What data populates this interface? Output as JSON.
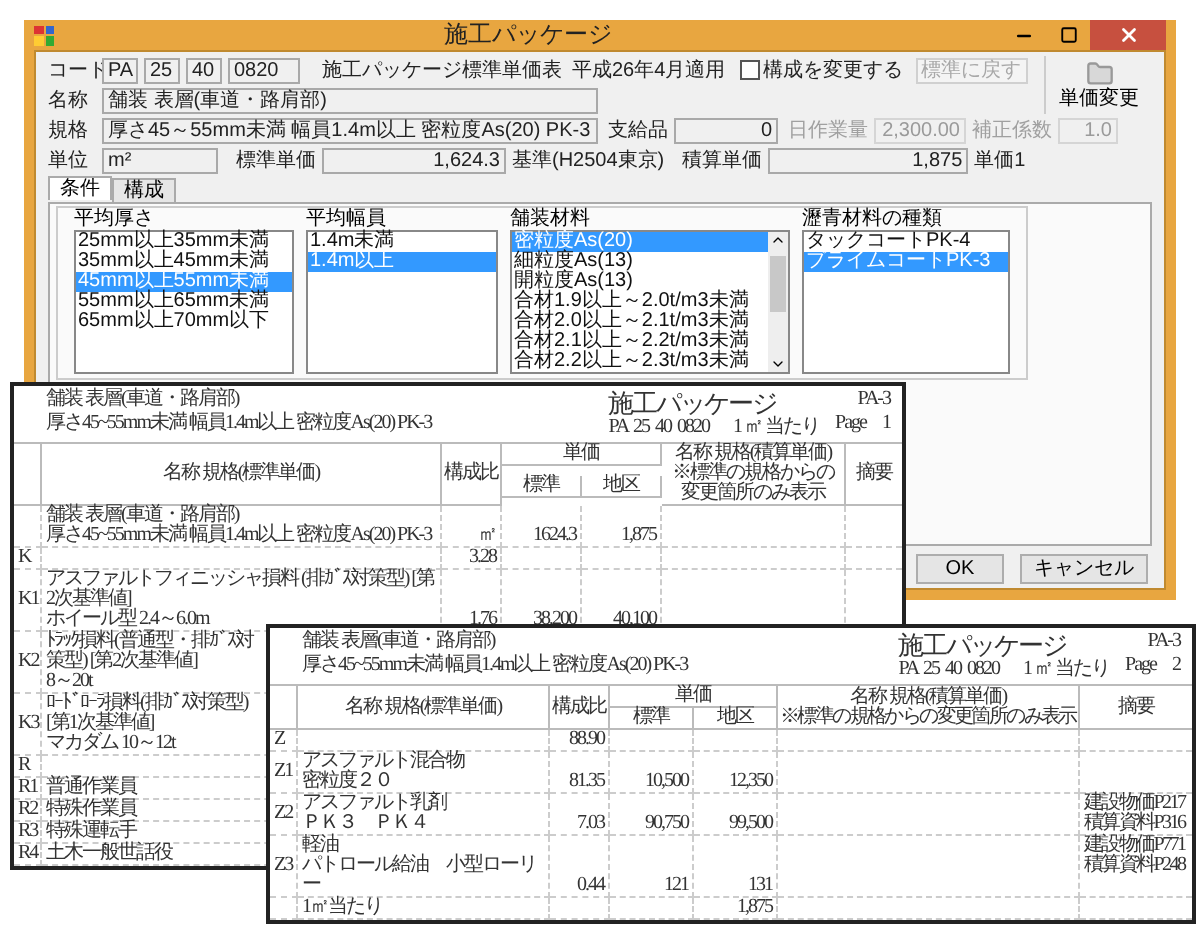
{
  "window": {
    "title": "施工パッケージ"
  },
  "header": {
    "code_label": "コード",
    "code": [
      "PA",
      "25",
      "40",
      "0820"
    ],
    "table_name": "施工パッケージ標準単価表",
    "applied": "平成26年4月適用",
    "change_structure": {
      "label": "構成を変更する",
      "checked": false
    },
    "reset_button": {
      "label": "標準に戻す",
      "disabled": true
    },
    "price_change_button": {
      "label": "単価変更"
    },
    "name": {
      "label": "名称",
      "value": "舗装 表層(車道・路肩部)"
    },
    "spec": {
      "label": "規格",
      "value": "厚さ45～55mm未満 幅員1.4m以上 密粒度As(20) PK-3"
    },
    "supplied": {
      "label": "支給品",
      "value": "0"
    },
    "daily_output": {
      "label": "日作業量",
      "value": "2,300.00",
      "disabled": true
    },
    "correction": {
      "label": "補正係数",
      "value": "1.0",
      "disabled": true
    },
    "unit": {
      "label": "単位",
      "value": "m²"
    },
    "standard_price": {
      "label": "標準単価",
      "value": "1,624.3"
    },
    "basis": "基準(H2504東京)",
    "estimate_price": {
      "label": "積算単価",
      "value": "1,875"
    },
    "price_note": "単価1"
  },
  "tabs": [
    {
      "label": "条件",
      "selected": true
    },
    {
      "label": "構成",
      "selected": false
    }
  ],
  "conditions": [
    {
      "title": "平均厚さ",
      "items": [
        {
          "label": "25mm以上35mm未満",
          "selected": false
        },
        {
          "label": "35mm以上45mm未満",
          "selected": false
        },
        {
          "label": "45mm以上55mm未満",
          "selected": true
        },
        {
          "label": "55mm以上65mm未満",
          "selected": false
        },
        {
          "label": "65mm以上70mm以下",
          "selected": false
        }
      ]
    },
    {
      "title": "平均幅員",
      "items": [
        {
          "label": "1.4m未満",
          "selected": false
        },
        {
          "label": "1.4m以上",
          "selected": true
        }
      ]
    },
    {
      "title": "舗装材料",
      "items": [
        {
          "label": "密粒度As(20)",
          "selected": true
        },
        {
          "label": "細粒度As(13)",
          "selected": false
        },
        {
          "label": "開粒度As(13)",
          "selected": false
        },
        {
          "label": "合材1.9以上～2.0t/m3未満",
          "selected": false
        },
        {
          "label": "合材2.0以上～2.1t/m3未満",
          "selected": false
        },
        {
          "label": "合材2.1以上～2.2t/m3未満",
          "selected": false
        },
        {
          "label": "合材2.2以上～2.3t/m3未満",
          "selected": false
        }
      ]
    },
    {
      "title": "瀝青材料の種類",
      "items": [
        {
          "label": "タックコートPK-4",
          "selected": false
        },
        {
          "label": "プライムコートPK-3",
          "selected": true
        }
      ]
    }
  ],
  "buttons": [
    {
      "label": "OK"
    },
    {
      "label": "キャンセル"
    }
  ],
  "pages": [
    {
      "heading": "舗装 表層(車道・路肩部)",
      "spec": "厚さ45~55mm未満 幅員1.4m以上 密粒度As(20) PK-3",
      "title": "施工パッケージ",
      "code": "PA  25  40  0820",
      "per_unit": "1 ㎡ 当たり",
      "form": "PA-3",
      "page_label": "Page",
      "page_no": "1",
      "columns": {
        "name": "名称 規格(標準単価)",
        "ratio": "構成比",
        "price": "単価",
        "standard": "標準",
        "district": "地区",
        "est_name": "名称 規格(積算単価)",
        "est_note": "※標準の規格からの変更箇所のみ表示",
        "remarks": "摘要"
      },
      "rows": [
        {
          "name": "舗装 表層(車道・路肩部)",
          "spec": "厚さ45~55mm未満 幅員1.4m以上 密粒度As(20) PK-3",
          "ratio": "㎡",
          "standard": "1624.3",
          "district": "1,875"
        },
        {
          "code": "K",
          "ratio": "3.28"
        },
        {
          "code": "K1",
          "name": "アスファルトフィニッシャ損料 (排ｶﾞｽ対策型) [第2次基準値]",
          "spec": "ホイール型 2.4～6.0m",
          "ratio": "1.76",
          "standard": "38,200",
          "district": "40,100"
        },
        {
          "code": "K2",
          "name": "ﾄﾗｯｸ損料(普通型・排ｶﾞｽ対策型) [第2次基準値]",
          "spec": "8～20t"
        },
        {
          "code": "K3",
          "name": "ﾛｰﾄﾞﾛｰﾗ損料(排ｶﾞｽ対策型) [第1次基準値]",
          "spec": "マカダム 10～12t"
        },
        {
          "code": "R"
        },
        {
          "code": "R1",
          "name": "普通作業員"
        },
        {
          "code": "R2",
          "name": "特殊作業員"
        },
        {
          "code": "R3",
          "name": "特殊運転手"
        },
        {
          "code": "R4",
          "name": "土木一般世話役"
        }
      ]
    },
    {
      "heading": "舗装 表層(車道・路肩部)",
      "spec": "厚さ45~55mm未満 幅員1.4m以上 密粒度As(20) PK-3",
      "title": "施工パッケージ",
      "code": "PA  25  40  0820",
      "per_unit": "1 ㎡ 当たり",
      "form": "PA-3",
      "page_label": "Page",
      "page_no": "2",
      "columns": {
        "name": "名称 規格(標準単価)",
        "ratio": "構成比",
        "price": "単価",
        "standard": "標準",
        "district": "地区",
        "est_name": "名称 規格(積算単価)",
        "est_note": "※標準の規格からの変更箇所のみ表示",
        "remarks": "摘要"
      },
      "rows": [
        {
          "code": "Z",
          "ratio": "88.90"
        },
        {
          "code": "Z1",
          "name": "アスファルト混合物",
          "spec": "密粒度２０",
          "ratio": "81.35",
          "standard": "10,500",
          "district": "12,350"
        },
        {
          "code": "Z2",
          "name": "アスファルト乳剤",
          "spec": "ＰＫ３　ＰＫ４",
          "ratio": "7.03",
          "standard": "90,750",
          "district": "99,500",
          "remarks": [
            "建設物価P217",
            "積算資料P316"
          ]
        },
        {
          "code": "Z3",
          "name": "軽油",
          "spec": "パトロール給油　小型ローリー",
          "ratio": "0.44",
          "standard": "121",
          "district": "131",
          "remarks": [
            "建設物価P771",
            "積算資料P248"
          ]
        },
        {
          "name": "1㎡当たり",
          "district": "1,875"
        }
      ]
    }
  ]
}
